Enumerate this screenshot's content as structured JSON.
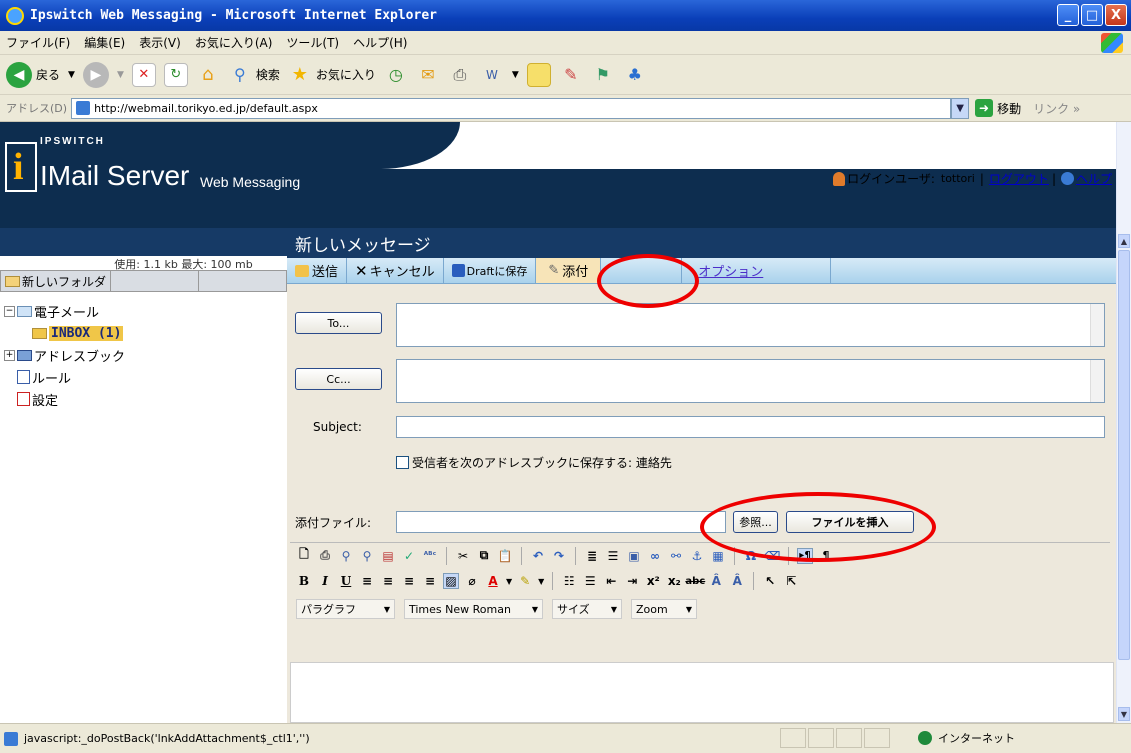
{
  "window": {
    "title": "Ipswitch Web Messaging - Microsoft Internet Explorer",
    "minimize": "_",
    "maximize": "□",
    "close": "X"
  },
  "menu": [
    "ファイル(F)",
    "編集(E)",
    "表示(V)",
    "お気に入り(A)",
    "ツール(T)",
    "ヘルプ(H)"
  ],
  "toolbar": {
    "back": "戻る",
    "search": "検索",
    "favorites": "お気に入り"
  },
  "address": {
    "label": "アドレス(D)",
    "url": "http://webmail.torikyo.ed.jp/default.aspx",
    "go": "移動",
    "links": "リンク »"
  },
  "header": {
    "brand_small": "IPSWITCH",
    "brand": "IMail Server",
    "brand_sub": "Web Messaging",
    "login_label": "ログインユーザ:",
    "login_user": "tottori",
    "sep": "|",
    "logout": "ログアウト",
    "help": "ヘルプ"
  },
  "sidebar": {
    "quota": "使用: 1.1 kb 最大: 100 mb",
    "new_folder": "新しいフォルダ",
    "tree": {
      "mail": "電子メール",
      "inbox": "INBOX (1)",
      "addressbook": "アドレスブック",
      "rules": "ルール",
      "settings": "設定"
    }
  },
  "compose": {
    "title": "新しいメッセージ",
    "actions": {
      "send": "送信",
      "cancel": "キャンセル",
      "draft": "Draftに保存",
      "attach": "添付",
      "options": "オプション"
    },
    "to_button": "To...",
    "cc_button": "Cc...",
    "subject_label": "Subject:",
    "save_recipients": "受信者を次のアドレスブックに保存する: 連絡先",
    "attach_label": "添付ファイル:",
    "browse": "参照...",
    "insert_file": "ファイルを挿入",
    "editor": {
      "paragraph": "パラグラフ",
      "font": "Times New Roman",
      "size": "サイズ",
      "zoom": "Zoom"
    }
  },
  "status": {
    "text": "javascript:_doPostBack('lnkAddAttachment$_ctl1','')",
    "zone": "インターネット"
  }
}
